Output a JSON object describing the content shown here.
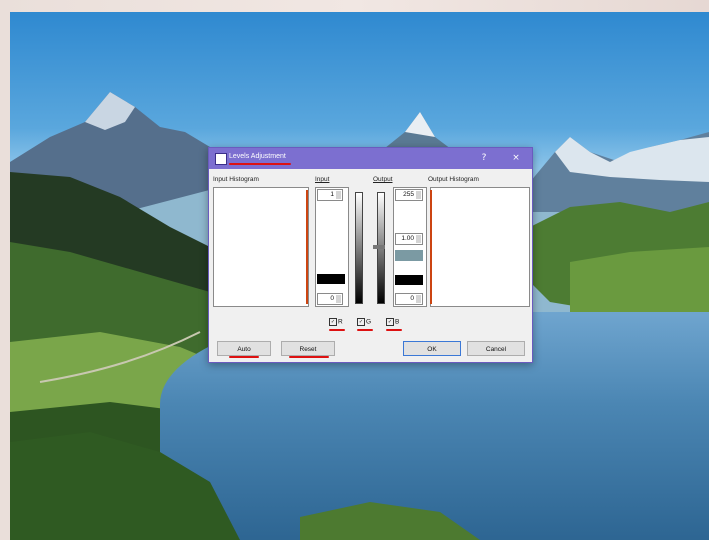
{
  "dialog": {
    "title": "Levels Adjustment",
    "icon": "levels-app-icon",
    "controls": {
      "help": "?",
      "close": "×"
    }
  },
  "labels": {
    "input_histogram": "Input Histogram",
    "input": "Input",
    "output": "Output",
    "output_histogram": "Output Histogram"
  },
  "input_spinners": {
    "top": "1",
    "bottom": "0"
  },
  "output_spinners": {
    "top": "255",
    "gamma": "1.00",
    "bottom": "0"
  },
  "channels": [
    {
      "label": "R",
      "checked": true
    },
    {
      "label": "G",
      "checked": true
    },
    {
      "label": "B",
      "checked": true
    }
  ],
  "buttons": {
    "auto": "Auto",
    "reset": "Reset",
    "ok": "OK",
    "cancel": "Cancel"
  },
  "colors": {
    "titlebar": "#7c6fd0",
    "accent_underline": "#d11111",
    "gamma_swatch": "#7b9aa3"
  }
}
